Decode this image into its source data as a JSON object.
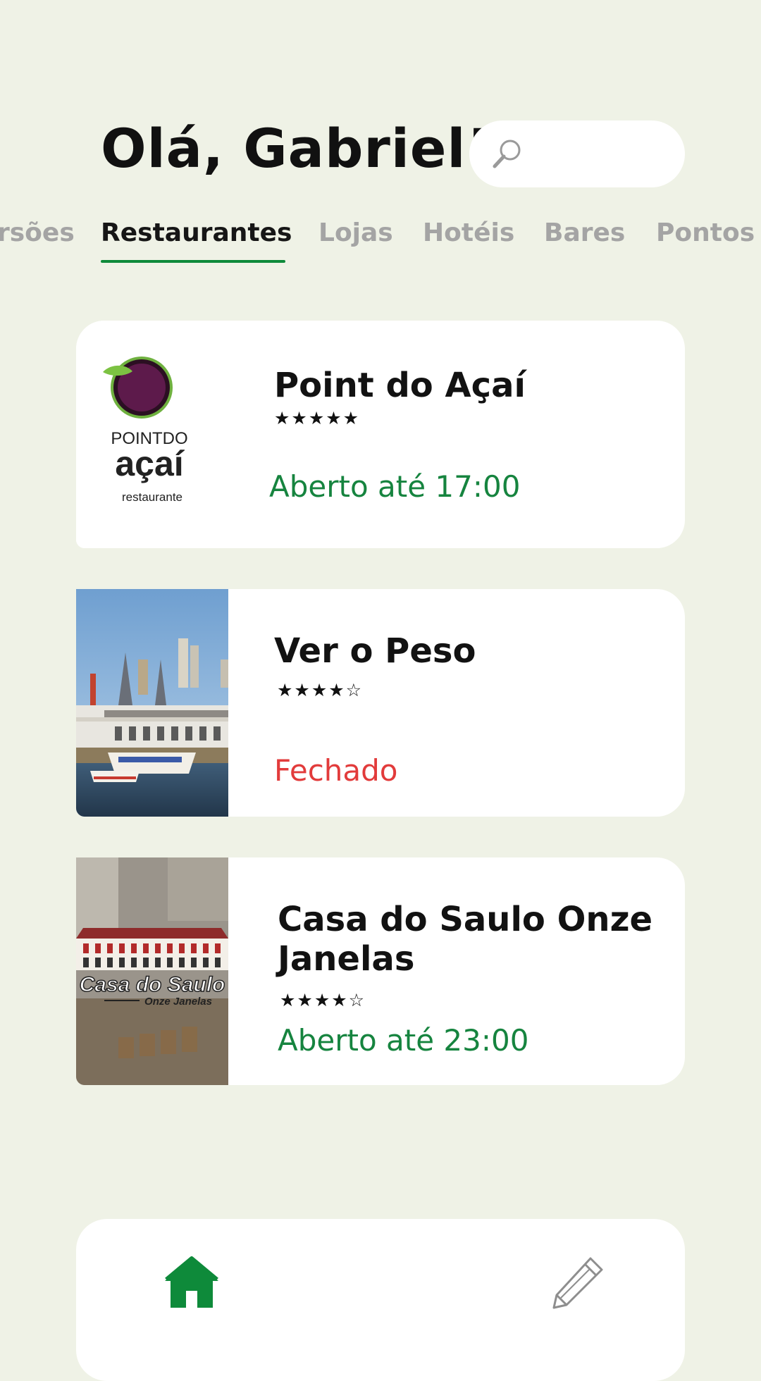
{
  "header": {
    "greeting": "Olá, Gabriel!",
    "search_placeholder": ""
  },
  "tabs": [
    {
      "label": "rsões",
      "active": false
    },
    {
      "label": "Restaurantes",
      "active": true
    },
    {
      "label": "Lojas",
      "active": false
    },
    {
      "label": "Hotéis",
      "active": false
    },
    {
      "label": "Bares",
      "active": false
    },
    {
      "label": "Pontos",
      "active": false
    }
  ],
  "places": [
    {
      "name": "Point do Açaí",
      "rating": 5,
      "stars": "★★★★★",
      "status": "Aberto até 17:00",
      "status_type": "open",
      "logo_text": "POINTDO",
      "logo_text2": "açaí",
      "logo_text3": "restaurante"
    },
    {
      "name": "Ver o Peso",
      "rating": 4,
      "stars": "★★★★☆",
      "status": "Fechado",
      "status_type": "closed"
    },
    {
      "name": "Casa do Saulo Onze Janelas",
      "rating": 4,
      "stars": "★★★★☆",
      "status": "Aberto até 23:00",
      "status_type": "open",
      "logo_text": "Casa do Saulo",
      "logo_text2": "Onze Janelas"
    }
  ],
  "nav": {
    "home_icon": "home-icon",
    "edit_icon": "pencil-icon"
  },
  "colors": {
    "background": "#eff2e6",
    "accent": "#0e8a3a",
    "open": "#16843f",
    "closed": "#e23b3b"
  }
}
